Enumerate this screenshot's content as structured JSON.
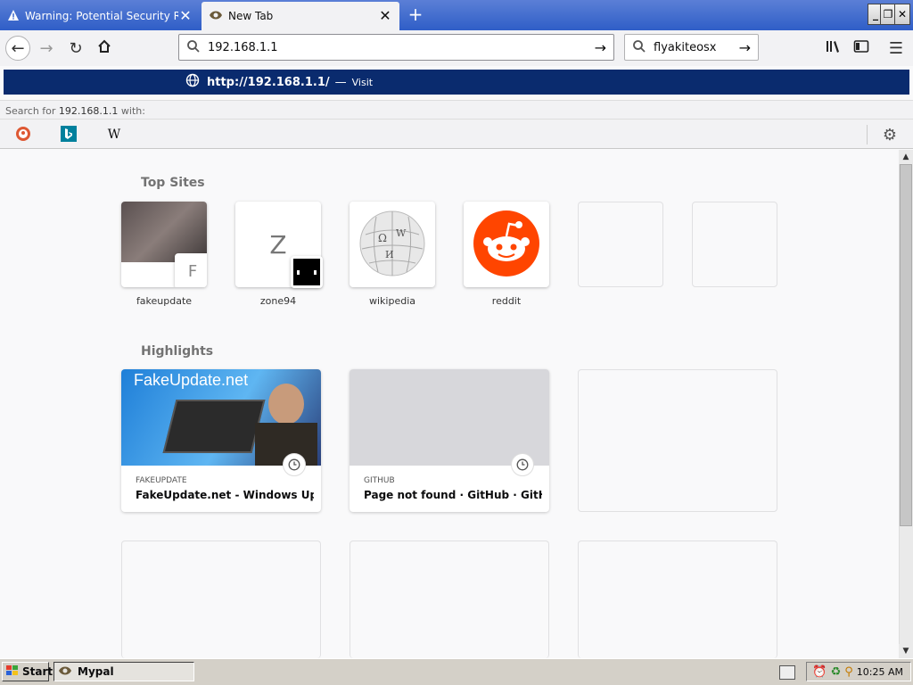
{
  "tabs": [
    {
      "title": "Warning: Potential Security Risk A",
      "icon": "warning-icon",
      "active": false
    },
    {
      "title": "New Tab",
      "icon": "mypal-icon",
      "active": true
    }
  ],
  "toolbar": {
    "url_value": "192.168.1.1",
    "search_value": "flyakiteosx"
  },
  "popup": {
    "url": "http://192.168.1.1/",
    "dash": "—",
    "visit": "Visit",
    "search_for_prefix": "Search for",
    "search_for_term": "192.168.1.1",
    "search_for_suffix": "with:",
    "engines": [
      "duckduckgo-icon",
      "bing-icon",
      "wikipedia-icon"
    ],
    "wiki_glyph": "W"
  },
  "top_sites": {
    "title": "Top Sites",
    "items": [
      {
        "label": "fakeupdate",
        "letter": "F"
      },
      {
        "label": "zone94",
        "letter": "Z"
      },
      {
        "label": "wikipedia"
      },
      {
        "label": "reddit"
      }
    ]
  },
  "highlights": {
    "title": "Highlights",
    "cards": [
      {
        "source": "FAKEUPDATE",
        "title": "FakeUpdate.net - Windows Upd...",
        "thumb_text": "FakeUpdate.net"
      },
      {
        "source": "GITHUB",
        "title": "Page not found · GitHub · GitHub"
      }
    ]
  },
  "taskbar": {
    "start_label": "Start",
    "task_label": "Mypal",
    "clock": "10:25 AM"
  },
  "colors": {
    "accent": "#0a2b6e",
    "reddit": "#ff4500"
  }
}
